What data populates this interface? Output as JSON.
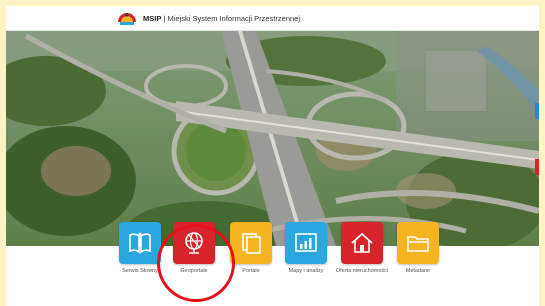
{
  "header": {
    "site_name": "MSIP",
    "subtitle": "| Miejski System Informacji Przestrzennej"
  },
  "tiles": [
    {
      "label": "Serwis Słowny",
      "icon": "info-book-icon",
      "color": "#29a8e0"
    },
    {
      "label": "Geoportale",
      "icon": "globe-icon",
      "color": "#d9232a"
    },
    {
      "label": "Portale",
      "icon": "pages-icon",
      "color": "#f6b421"
    },
    {
      "label": "Mapy i analizy",
      "icon": "bar-chart-icon",
      "color": "#29a8e0"
    },
    {
      "label": "Oferta nieruchomości",
      "icon": "house-icon",
      "color": "#d9232a"
    },
    {
      "label": "Metadane",
      "icon": "folder-icon",
      "color": "#f6b421"
    }
  ],
  "colors": {
    "annotation": "#e8101a",
    "background": "#fcf4c4"
  }
}
